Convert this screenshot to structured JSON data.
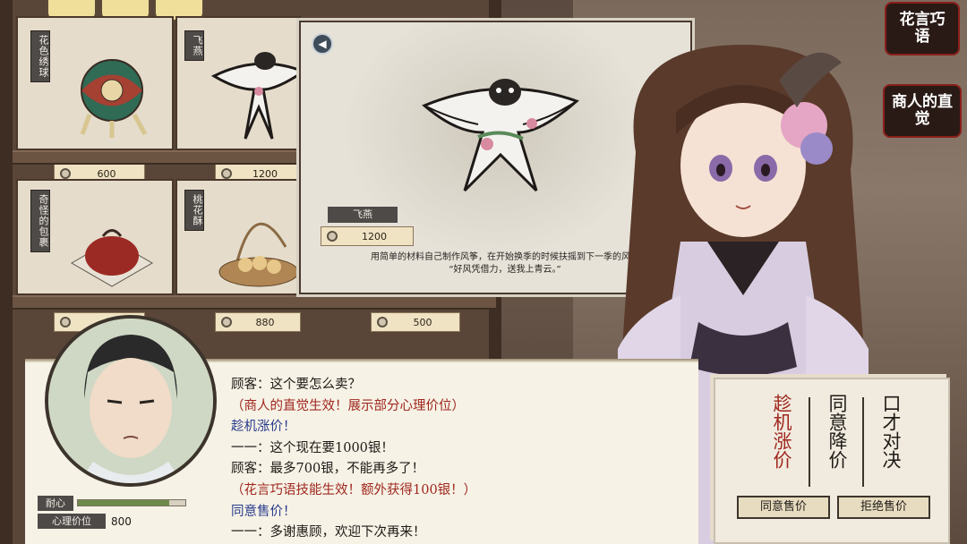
{
  "shop": {
    "items": [
      {
        "name": "花色绣球",
        "price": "600"
      },
      {
        "name": "飞燕",
        "price": "1200"
      },
      {
        "name": "奇怪的包裹",
        "price": ""
      },
      {
        "name": "桃花酥",
        "price": "880"
      },
      {
        "name": "",
        "price": "500"
      }
    ]
  },
  "popup": {
    "name": "飞燕",
    "price": "1200",
    "desc_line1": "用简单的材料自己制作风筝，在开始换季的时候扶摇到下一季的风。",
    "desc_line2": "“好风凭借力，送我上青云。”"
  },
  "skills": {
    "flowery_words": "花言巧语",
    "merchant_instinct": "商人的直觉"
  },
  "dialog": {
    "lines": [
      {
        "text": "顾客：这个要怎么卖？",
        "style": "normal"
      },
      {
        "text": "（商人的直觉生效！展示部分心理价位）",
        "style": "red"
      },
      {
        "text": "趁机涨价！",
        "style": "blue"
      },
      {
        "text": "一一：这个现在要1000银！",
        "style": "normal"
      },
      {
        "text": "顾客：最多700银，不能再多了！",
        "style": "normal"
      },
      {
        "text": "（花言巧语技能生效！额外获得100银！）",
        "style": "red"
      },
      {
        "text": "同意售价！",
        "style": "blue"
      },
      {
        "text": "一一：多谢惠顾，欢迎下次再来！",
        "style": "normal"
      }
    ]
  },
  "customer": {
    "patience_label": "耐心",
    "patience": 0.85,
    "price_label": "心理价位",
    "price_value": "800"
  },
  "choices": {
    "options": [
      "趁机涨价",
      "同意降价",
      "口才对决"
    ],
    "agree_button": "同意售价",
    "refuse_button": "拒绝售价"
  },
  "colors": {
    "accent_red": "#a0271e",
    "accent_blue": "#2a3b8c"
  }
}
